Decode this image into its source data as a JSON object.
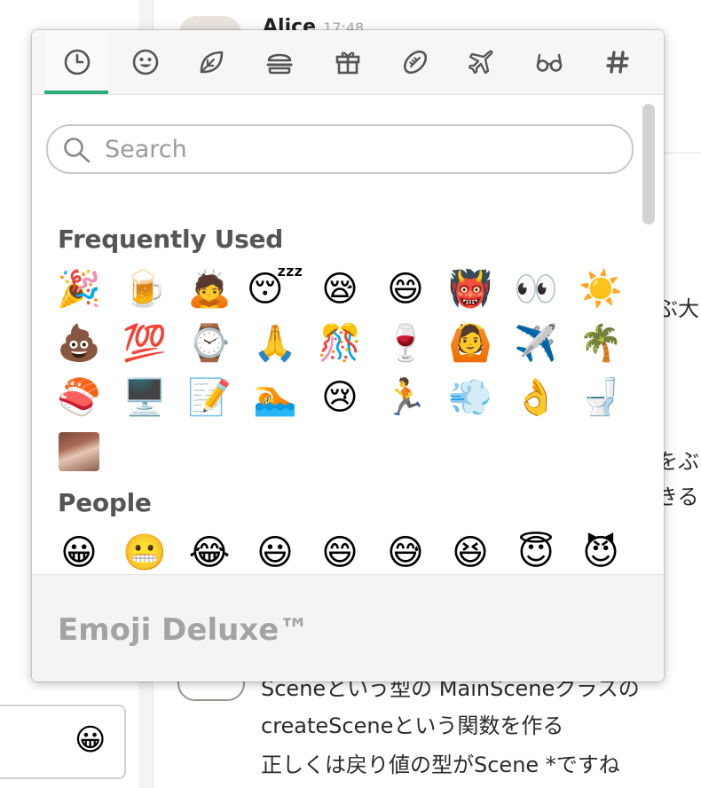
{
  "chat": {
    "author": "Alice",
    "time": "17:48",
    "fragments": [
      "ぶ大ス",
      "をぶ",
      "きる",
      "Sceneという型の  MainSceneクラスの",
      "createSceneという関数を作る",
      "正しくは戻り値の型がScene *ですね"
    ]
  },
  "composer": {
    "emoji_button_glyph": "😀"
  },
  "picker": {
    "tabs": [
      {
        "name": "recent-tab",
        "icon": "clock-icon"
      },
      {
        "name": "people-tab",
        "icon": "smiley-icon"
      },
      {
        "name": "nature-tab",
        "icon": "leaf-icon"
      },
      {
        "name": "food-tab",
        "icon": "burger-icon"
      },
      {
        "name": "celebration-tab",
        "icon": "gift-icon"
      },
      {
        "name": "activity-tab",
        "icon": "football-icon"
      },
      {
        "name": "travel-tab",
        "icon": "airplane-icon"
      },
      {
        "name": "objects-tab",
        "icon": "glasses-icon"
      },
      {
        "name": "symbols-tab",
        "icon": "hash-icon"
      }
    ],
    "active_tab": 0,
    "accent_color": "#2bac76",
    "search": {
      "placeholder": "Search",
      "value": ""
    },
    "sections": [
      {
        "title": "Frequently Used",
        "emojis": [
          "🎉",
          "🍺",
          "🙇",
          "😴",
          "😪",
          "😄",
          "👹",
          "👀",
          "☀️",
          "💩",
          "💯",
          "⌚",
          "🙏",
          "🎊",
          "🍷",
          "🙆",
          "✈️",
          "🌴",
          "🍣",
          "🖥️",
          "📝",
          "🏊",
          "😢",
          "🏃",
          "💨",
          "👌",
          "🚽",
          "custom-avatar"
        ]
      },
      {
        "title": "People",
        "emojis": [
          "😀",
          "😬",
          "😂",
          "😃",
          "😄",
          "😅",
          "😆",
          "😇",
          "😈",
          "👿",
          "😉",
          "😊",
          "😌",
          "😍",
          "😎",
          "😏"
        ]
      }
    ],
    "footer_title": "Emoji Deluxe™"
  }
}
